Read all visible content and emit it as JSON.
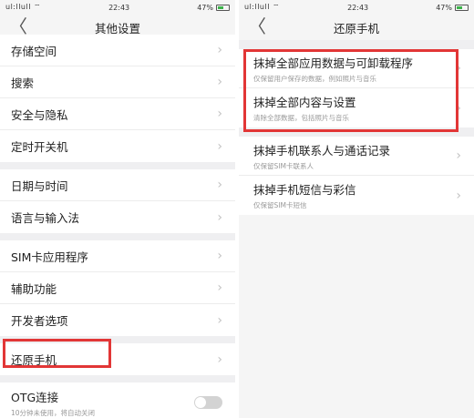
{
  "left": {
    "status": {
      "signal": "ul:llull ⌔",
      "time": "22:43",
      "battery": "47%"
    },
    "title": "其他设置",
    "back_glyph": "〈",
    "groups": [
      [
        "存储空间",
        "搜索",
        "安全与隐私",
        "定时开关机"
      ],
      [
        "日期与时间",
        "语言与输入法"
      ],
      [
        "SIM卡应用程序",
        "辅助功能",
        "开发者选项"
      ],
      [
        "还原手机"
      ]
    ],
    "otg": {
      "label": "OTG连接",
      "sub": "10分钟未使用，将自动关闭"
    }
  },
  "right": {
    "status": {
      "signal": "ul:llull ⌔",
      "time": "22:43",
      "battery": "47%"
    },
    "title": "还原手机",
    "back_glyph": "〈",
    "groups": [
      [
        {
          "label": "抹掉全部应用数据与可卸载程序",
          "sub": "仅保留用户保存的数据，例如照片与音乐"
        },
        {
          "label": "抹掉全部内容与设置",
          "sub": "清除全部数据，包括照片与音乐"
        }
      ],
      [
        {
          "label": "抹掉手机联系人与通话记录",
          "sub": "仅保留SIM卡联系人"
        },
        {
          "label": "抹掉手机短信与彩信",
          "sub": "仅保留SIM卡短信"
        }
      ]
    ]
  },
  "chevron": "›",
  "colors": {
    "highlight": "#e23636",
    "battery": "#3cb34a"
  }
}
